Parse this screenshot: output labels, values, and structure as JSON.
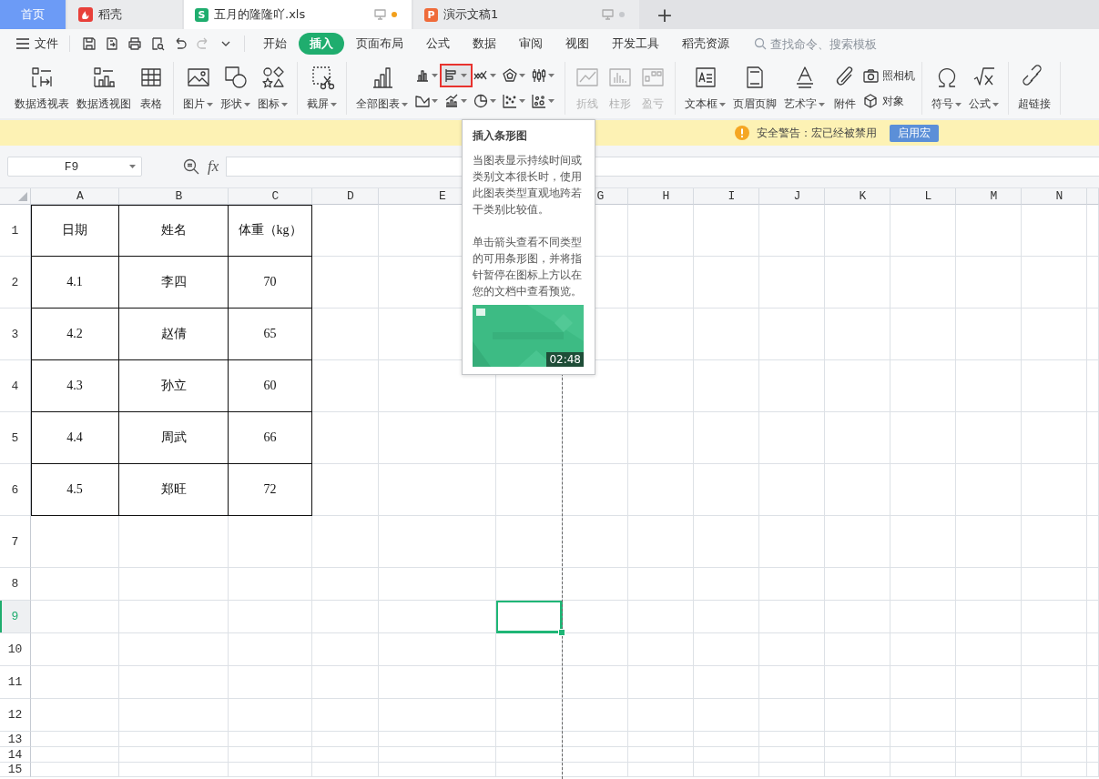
{
  "doc_tabs": [
    {
      "kind": "home",
      "label": "首页",
      "selected": false
    },
    {
      "kind": "docer",
      "label": "稻壳",
      "selected": false
    },
    {
      "kind": "sheet",
      "badge": "S",
      "label": "五月的隆隆吖.xls",
      "selected": true,
      "modified": true
    },
    {
      "kind": "slides",
      "badge": "P",
      "label": "演示文稿1",
      "selected": false,
      "modified": false
    }
  ],
  "new_tab": "+",
  "menu": {
    "file": "文件",
    "quick_access": [
      {
        "disabled": false
      },
      {
        "disabled": false
      },
      {
        "disabled": false
      },
      {
        "disabled": false
      },
      {
        "disabled": false
      },
      {
        "disabled": true
      },
      {
        "disabled": false
      }
    ],
    "tabs": [
      {
        "label": "开始",
        "selected": false
      },
      {
        "label": "插入",
        "selected": true
      },
      {
        "label": "页面布局",
        "selected": false
      },
      {
        "label": "公式",
        "selected": false
      },
      {
        "label": "数据",
        "selected": false
      },
      {
        "label": "审阅",
        "selected": false
      },
      {
        "label": "视图",
        "selected": false
      },
      {
        "label": "开发工具",
        "selected": false
      },
      {
        "label": "稻壳资源",
        "selected": false
      }
    ],
    "search": {
      "placeholder": "查找命令、搜索模板"
    }
  },
  "ribbon": {
    "groups": [
      {
        "items": [
          {
            "kind": "big",
            "label": "数据透视表",
            "dropdown": false,
            "disabled": false
          },
          {
            "kind": "big",
            "label": "数据透视图",
            "dropdown": false,
            "disabled": false
          },
          {
            "kind": "big",
            "label": "表格",
            "dropdown": false,
            "disabled": false
          }
        ]
      },
      {
        "items": [
          {
            "kind": "big",
            "label": "图片",
            "dropdown": true,
            "disabled": false
          },
          {
            "kind": "big",
            "label": "形状",
            "dropdown": true,
            "disabled": false
          },
          {
            "kind": "big",
            "label": "图标",
            "dropdown": true,
            "disabled": false
          }
        ]
      },
      {
        "items": [
          {
            "kind": "big",
            "label": "截屏",
            "dropdown": true,
            "disabled": false
          }
        ]
      },
      {
        "items": [
          {
            "kind": "big",
            "label": "全部图表",
            "dropdown": true,
            "disabled": false
          },
          {
            "kind": "mini",
            "dropdown": true,
            "hovered": false
          },
          {
            "kind": "mini",
            "dropdown": true,
            "hovered": true
          },
          {
            "kind": "mini",
            "dropdown": true,
            "hovered": false
          },
          {
            "kind": "mini",
            "dropdown": true,
            "hovered": false
          },
          {
            "kind": "mini",
            "dropdown": true,
            "hovered": false
          },
          {
            "kind": "mini",
            "dropdown": true,
            "hovered": false
          },
          {
            "kind": "mini",
            "dropdown": true,
            "hovered": false
          },
          {
            "kind": "mini",
            "dropdown": true,
            "hovered": false
          },
          {
            "kind": "mini",
            "dropdown": true,
            "hovered": false
          },
          {
            "kind": "mini",
            "dropdown": true,
            "hovered": false
          }
        ]
      },
      {
        "items": [
          {
            "kind": "big",
            "label": "折线",
            "dropdown": false,
            "disabled": true
          },
          {
            "kind": "big",
            "label": "柱形",
            "dropdown": false,
            "disabled": true
          },
          {
            "kind": "big",
            "label": "盈亏",
            "dropdown": false,
            "disabled": true
          }
        ]
      },
      {
        "items": [
          {
            "kind": "big",
            "label": "文本框",
            "dropdown": true,
            "disabled": false
          },
          {
            "kind": "big",
            "label": "页眉页脚",
            "dropdown": false,
            "disabled": false
          },
          {
            "kind": "big",
            "label": "艺术字",
            "dropdown": true,
            "disabled": false
          },
          {
            "kind": "big",
            "label": "附件",
            "dropdown": false,
            "disabled": false
          },
          {
            "kind": "side",
            "label": "照相机",
            "disabled": false
          },
          {
            "kind": "side",
            "label": "对象",
            "disabled": false
          }
        ]
      },
      {
        "items": [
          {
            "kind": "big",
            "label": "符号",
            "dropdown": true,
            "disabled": false
          },
          {
            "kind": "big",
            "label": "公式",
            "dropdown": true,
            "disabled": false
          }
        ]
      },
      {
        "items": [
          {
            "kind": "big",
            "label": "超链接",
            "dropdown": false,
            "disabled": false
          }
        ]
      }
    ]
  },
  "warning": {
    "message": "安全警告：宏已经被禁用",
    "button": "启用宏"
  },
  "formula_bar": {
    "cell_name": "F9",
    "fx": "fx"
  },
  "sheet": {
    "columns": [
      {
        "label": "A",
        "selected": false
      },
      {
        "label": "B",
        "selected": false
      },
      {
        "label": "C",
        "selected": false
      },
      {
        "label": "D",
        "selected": false
      },
      {
        "label": "E",
        "selected": false
      },
      {
        "selected": true
      },
      {
        "label": "G",
        "selected": false
      },
      {
        "label": "H",
        "selected": false
      },
      {
        "label": "I",
        "selected": false
      },
      {
        "label": "J",
        "selected": false
      },
      {
        "label": "K",
        "selected": false
      },
      {
        "label": "L",
        "selected": false
      },
      {
        "label": "M",
        "selected": false
      },
      {
        "label": "N",
        "selected": false
      },
      {
        "selected": false
      }
    ],
    "rows": [
      {
        "label": "1",
        "selected": false,
        "borders": true,
        "cells": [
          "日期",
          "姓名",
          "体重（kg）"
        ]
      },
      {
        "label": "2",
        "selected": false,
        "borders": true,
        "cells": [
          "4.1",
          "李四",
          "70"
        ]
      },
      {
        "label": "3",
        "selected": false,
        "borders": true,
        "cells": [
          "4.2",
          "赵倩",
          "65"
        ]
      },
      {
        "label": "4",
        "selected": false,
        "borders": true,
        "cells": [
          "4.3",
          "孙立",
          "60"
        ]
      },
      {
        "label": "5",
        "selected": false,
        "borders": true,
        "cells": [
          "4.4",
          "周武",
          "66"
        ]
      },
      {
        "label": "6",
        "selected": false,
        "borders": true,
        "cells": [
          "4.5",
          "郑旺",
          "72"
        ]
      },
      {
        "label": "7",
        "selected": false
      },
      {
        "label": "8",
        "selected": false
      },
      {
        "label": "9",
        "selected": true
      },
      {
        "label": "10",
        "selected": false
      },
      {
        "label": "11",
        "selected": false
      },
      {
        "label": "12",
        "selected": false
      },
      {
        "label": "13",
        "selected": false
      },
      {
        "label": "14",
        "selected": false
      },
      {
        "label": "15",
        "selected": false
      }
    ]
  },
  "tooltip": {
    "title": "插入条形图",
    "paragraphs": [
      "当图表显示持续时间或类别文本很长时，使用此图表类型直观地跨若干类别比较值。",
      "单击箭头查看不同类型的可用条形图，并将指针暂停在图标上方以在您的文档中查看预览。"
    ],
    "video": {
      "kind": "picture",
      "duration": "02:48"
    }
  }
}
